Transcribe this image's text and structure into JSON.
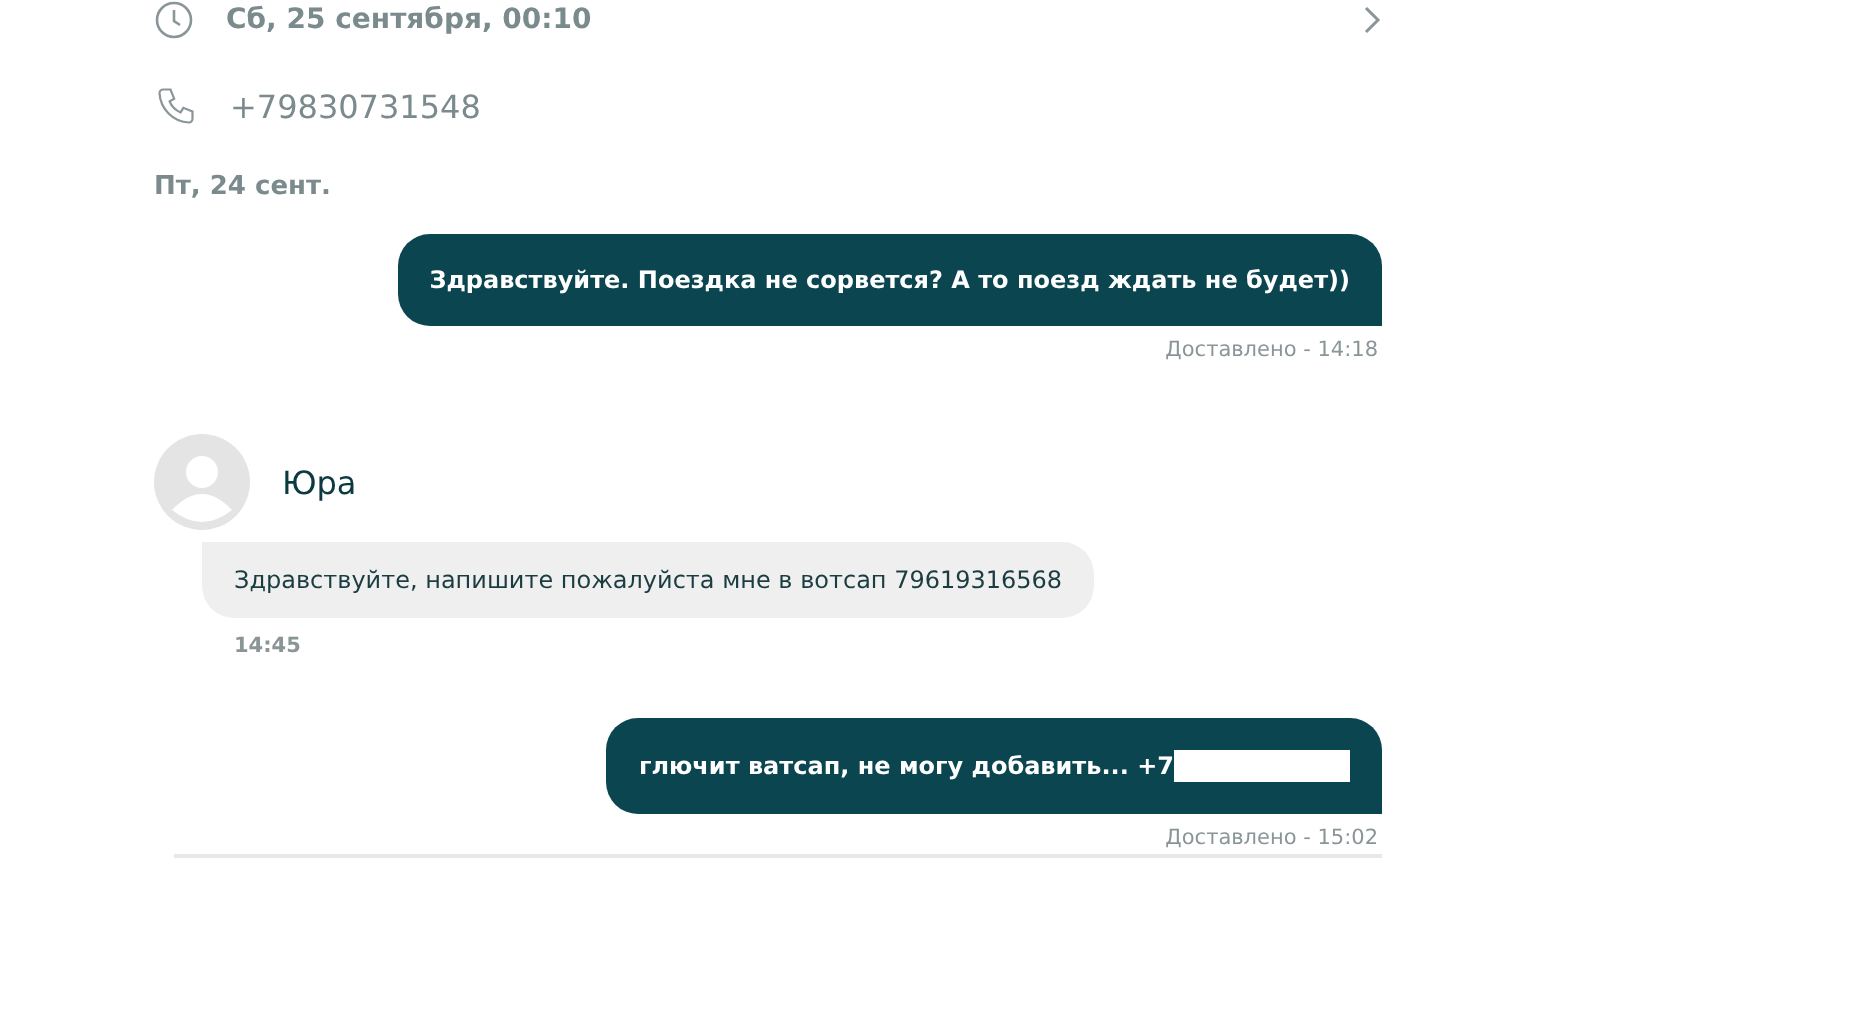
{
  "trip": {
    "datetime": "Сб, 25 сентября, 00:10",
    "phone": "+79830731548"
  },
  "day_label": "Пт, 24 сент.",
  "messages": [
    {
      "kind": "outgoing",
      "text": "Здравствуйте. Поездка не сорвется? А то поезд ждать не будет))",
      "status": "Доставлено - 14:18",
      "redacted": false
    },
    {
      "kind": "incoming",
      "author": "Юра",
      "text": "Здравствуйте, напишите пожалуйста мне в вотсап 79619316568",
      "time": "14:45"
    },
    {
      "kind": "outgoing",
      "text": "глючит ватсап, не могу добавить... +7",
      "status": "Доставлено - 15:02",
      "redacted": true
    }
  ]
}
